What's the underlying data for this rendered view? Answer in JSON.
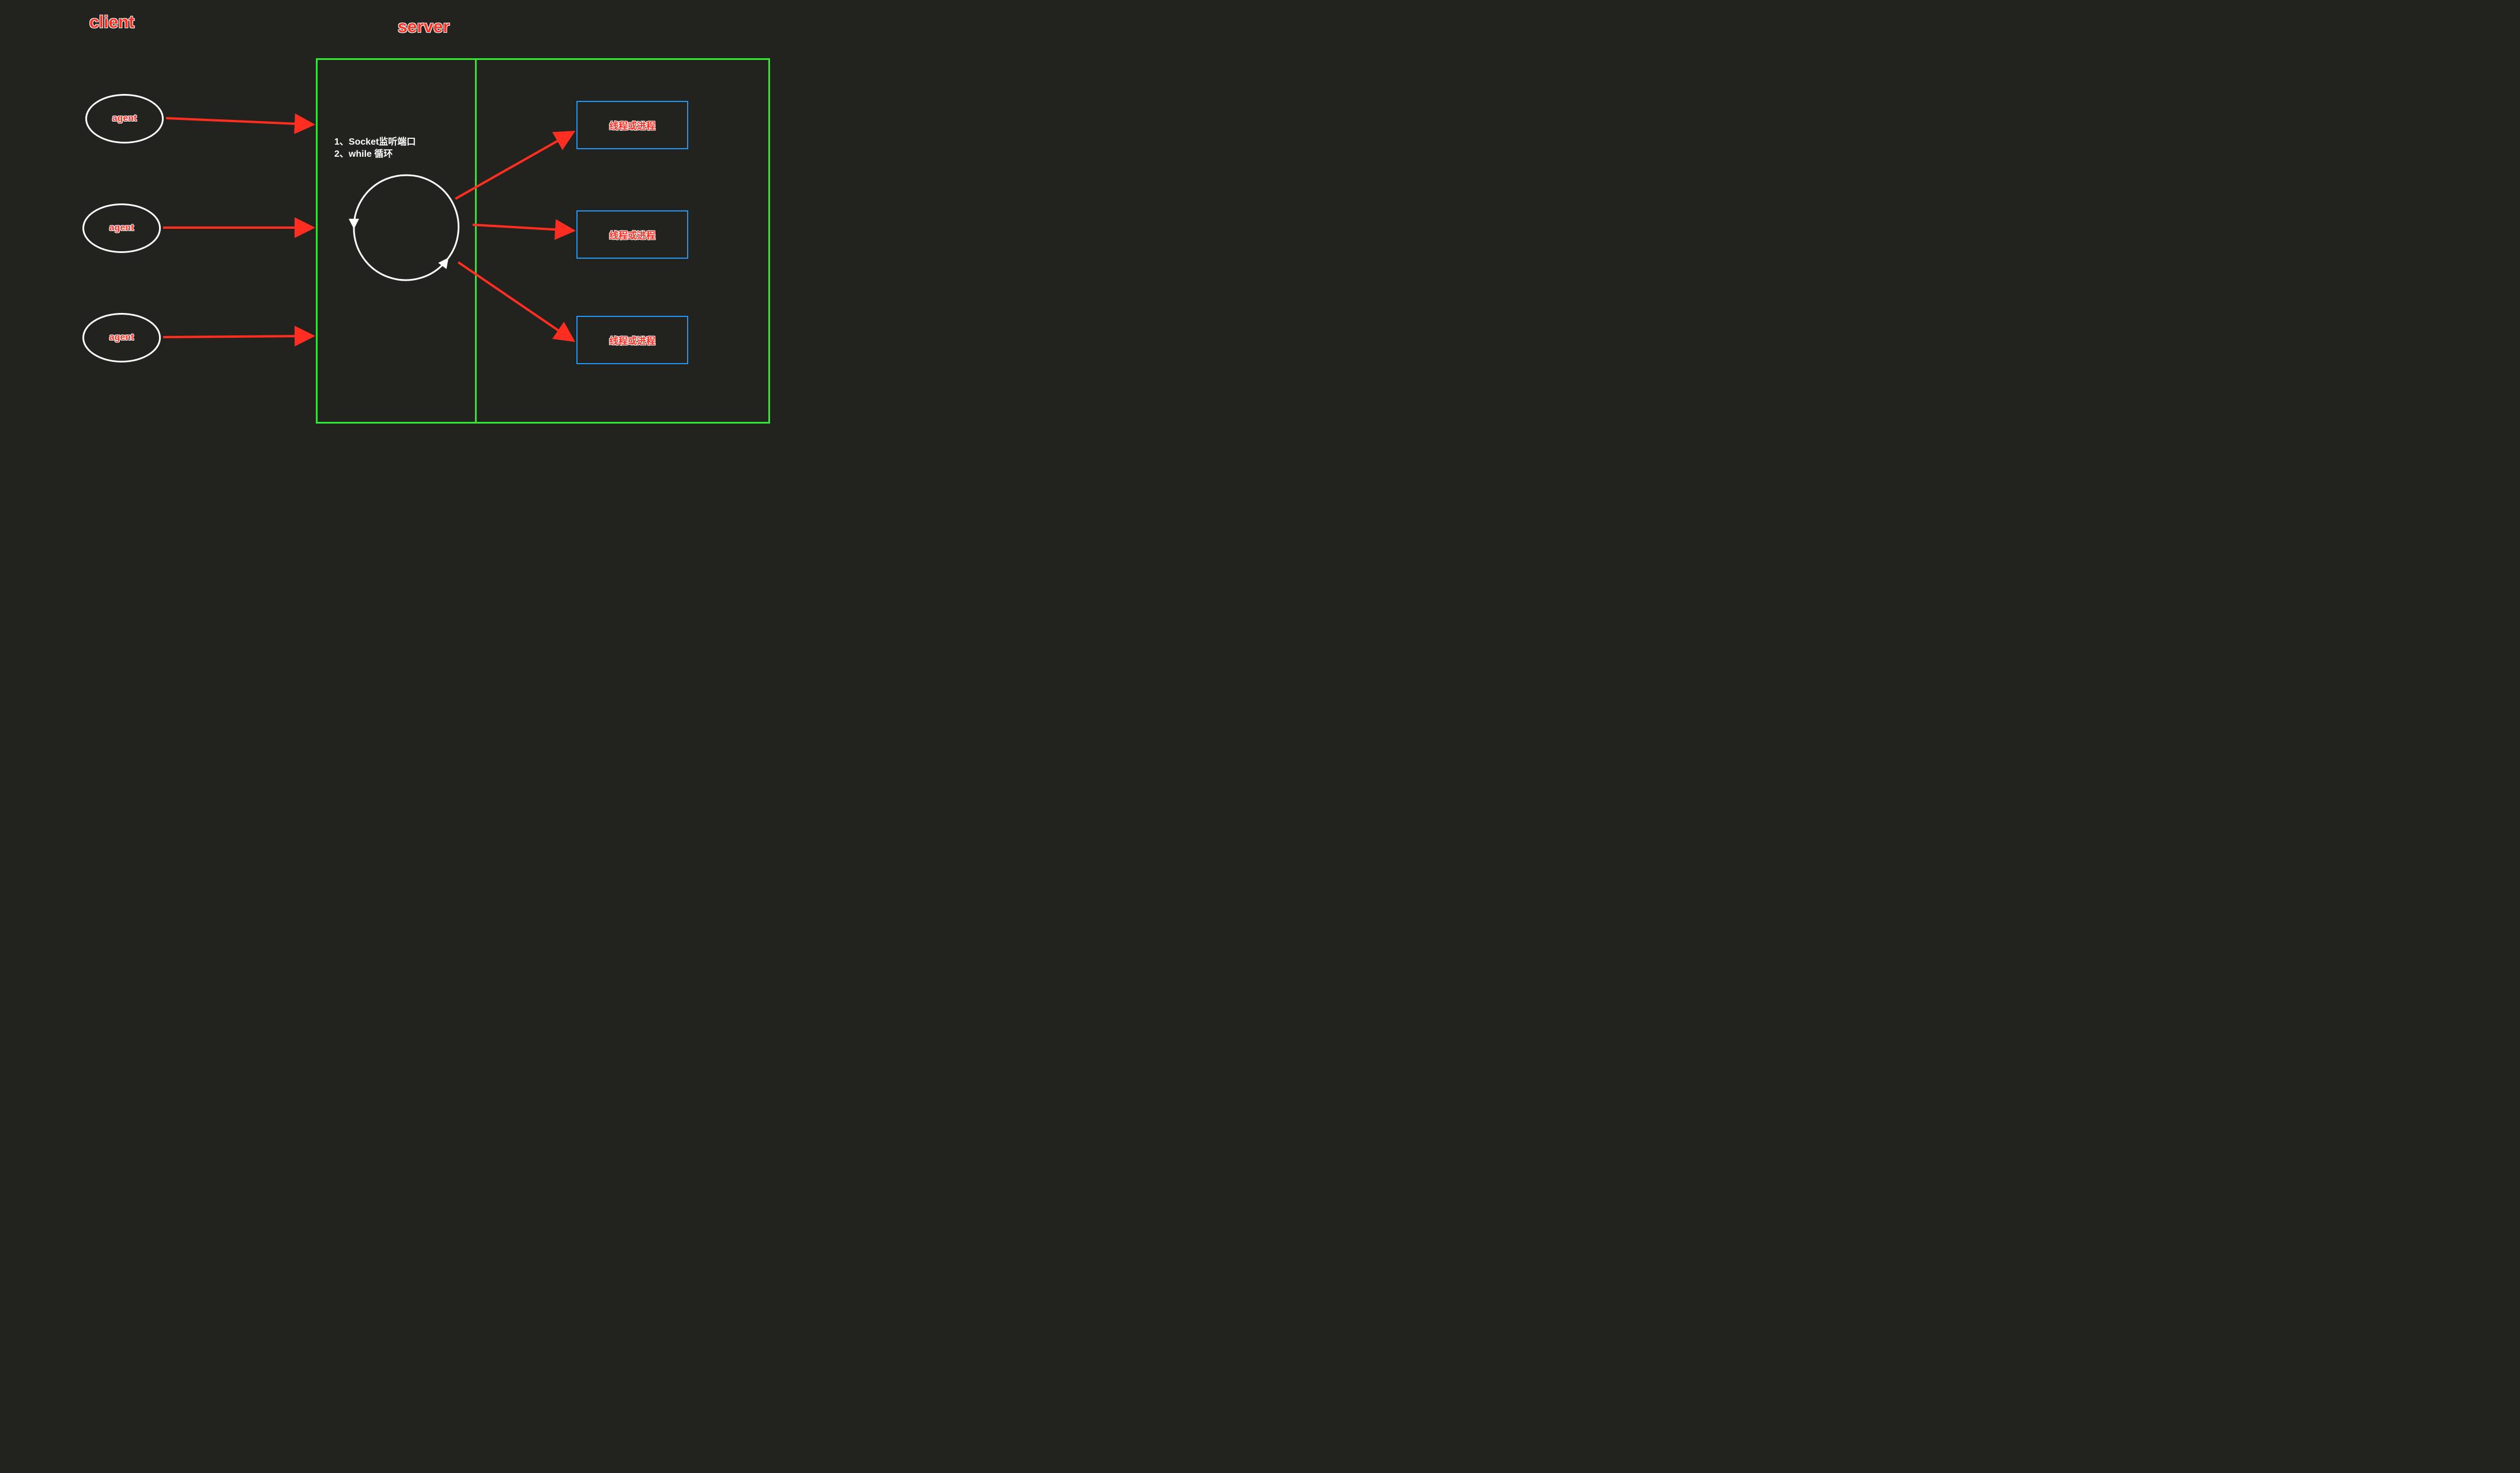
{
  "titles": {
    "client": "client",
    "server": "server"
  },
  "agents": [
    {
      "label": "agent"
    },
    {
      "label": "agent"
    },
    {
      "label": "agent"
    }
  ],
  "loop_note": {
    "line1": "1、Socket监听端口",
    "line2": "2、while 循环"
  },
  "threads": [
    {
      "label": "线程或进程"
    },
    {
      "label": "线程或进程"
    },
    {
      "label": "线程或进程"
    }
  ],
  "colors": {
    "bg": "#22231f",
    "red": "#ff2e20",
    "green": "#2fe82f",
    "blue": "#2196f3",
    "white": "#ffffff"
  },
  "diagram": {
    "description": "Client agents send requests via arrows into a server container; a socket listener + while loop circle dispatches each connection to a thread/process box.",
    "arrows_client_to_server": 3,
    "arrows_loop_to_threads": 3
  }
}
